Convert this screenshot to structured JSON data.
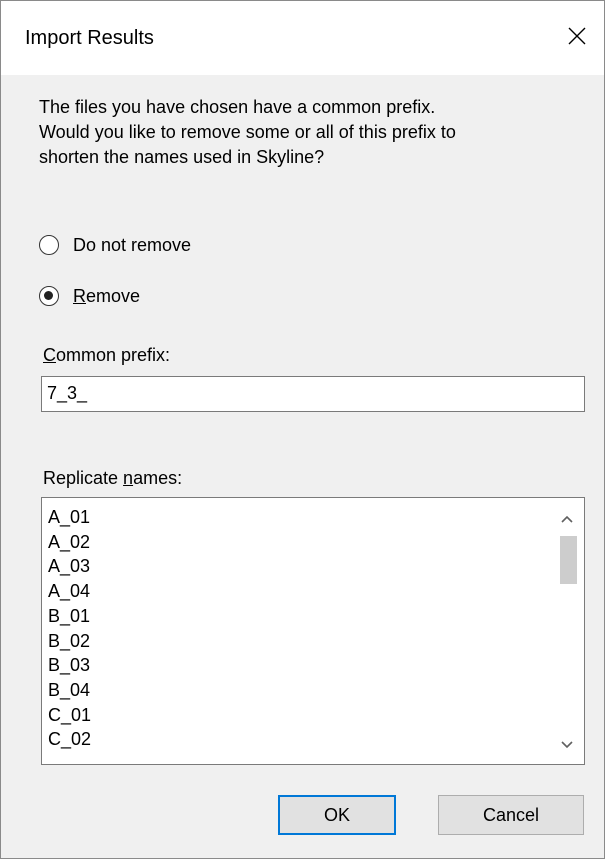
{
  "dialog": {
    "title": "Import Results",
    "message": "The files you have chosen have a common prefix.\nWould you like to remove some or all of this prefix to\nshorten the names used in Skyline?"
  },
  "options": {
    "do_not_remove": "Do not remove",
    "remove_first": "R",
    "remove_rest": "emove",
    "selected": "remove"
  },
  "prefix": {
    "label_first": "C",
    "label_rest": "ommon prefix:",
    "value": "7_3_"
  },
  "replicates": {
    "label_before": "Replicate ",
    "label_underlined": "n",
    "label_after": "ames:",
    "items": [
      "A_01",
      "A_02",
      "A_03",
      "A_04",
      "B_01",
      "B_02",
      "B_03",
      "B_04",
      "C_01",
      "C_02"
    ]
  },
  "buttons": {
    "ok": "OK",
    "cancel": "Cancel"
  },
  "icons": {
    "close": "close-icon",
    "scroll_up": "chevron-up-icon",
    "scroll_down": "chevron-down-icon"
  },
  "colors": {
    "default_button_border": "#0078d7",
    "window_background": "#f0f0f0"
  }
}
